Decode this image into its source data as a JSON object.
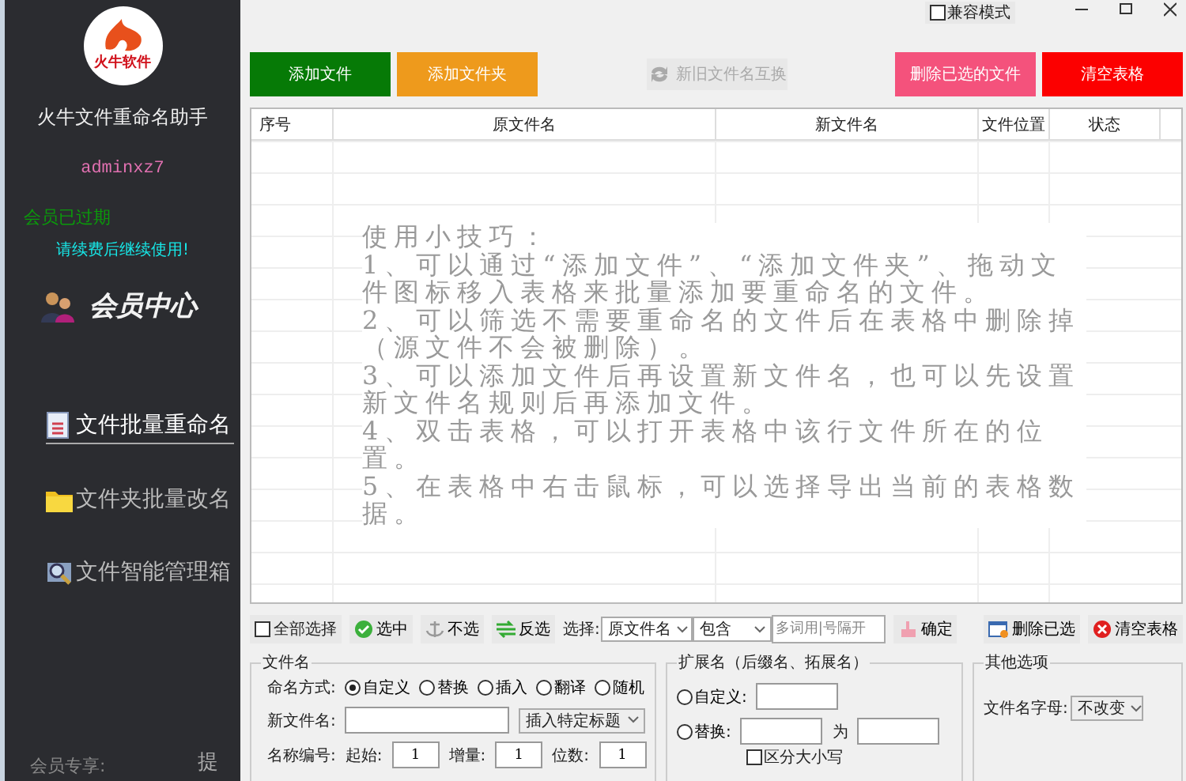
{
  "sidebar": {
    "logo_text": "火牛软件",
    "app_name": "火牛文件重命名助手",
    "username": "adminxz7",
    "membership_status": "会员已过期",
    "renew_notice": "请续费后继续使用!",
    "member_center": "会员中心",
    "nav": [
      {
        "kind": "document",
        "label": "文件批量重命名",
        "selected": true
      },
      {
        "kind": "folder",
        "label": "文件夹批量改名",
        "selected": false
      },
      {
        "kind": "search",
        "label": "文件智能管理箱",
        "selected": false
      }
    ],
    "footer_text": "会员专享:",
    "side_tab": "提"
  },
  "titlebar": {
    "compat_mode": {
      "label": "兼容模式",
      "checked": false
    }
  },
  "toolbar": [
    {
      "kind": "plain",
      "label": "添加文件",
      "color": "#067a06",
      "disabled": false
    },
    {
      "kind": "plain",
      "label": "添加文件夹",
      "color": "#ee9a1c",
      "disabled": false
    },
    {
      "kind": "swap",
      "label": "新旧文件名互换",
      "color": "#e8e8e8",
      "disabled": true
    },
    {
      "kind": "plain",
      "label": "删除已选的文件",
      "color": "#f4527c",
      "disabled": false
    },
    {
      "kind": "plain",
      "label": "清空表格",
      "color": "#fc0000",
      "disabled": false
    }
  ],
  "table": {
    "columns": [
      "序号",
      "原文件名",
      "新文件名",
      "文件位置",
      "状态"
    ],
    "tips": [
      "使用小技巧：",
      "1、可以通过“添加文件”、“添加文件夹”、拖动文件图标移入表格来批量添加要重命名的文件。",
      "2、可以筛选不需要重命名的文件后在表格中删除掉（源文件不会被删除）。",
      "3、可以添加文件后再设置新文件名，也可以先设置新文件名规则后再添加文件。",
      "4、双击表格，可以打开表格中该行文件所在的位置。",
      "5、在表格中右击鼠标，可以选择导出当前的表格数据。"
    ]
  },
  "selection_bar": {
    "select_all": {
      "label": "全部选择",
      "checked": false
    },
    "actions": [
      {
        "kind": "select",
        "label": "选中"
      },
      {
        "kind": "deselect",
        "label": "不选"
      },
      {
        "kind": "invert",
        "label": "反选"
      }
    ],
    "filter_label": "选择:",
    "field": "原文件名",
    "match": "包含",
    "keywords_placeholder": "多词用|号隔开",
    "confirm": "确定",
    "delete_selected": "删除已选",
    "clear_table": "清空表格"
  },
  "filename": {
    "title": "文件名",
    "mode_label": "命名方式:",
    "modes": [
      {
        "label": "自定义",
        "selected": true
      },
      {
        "label": "替换",
        "selected": false
      },
      {
        "label": "插入",
        "selected": false
      },
      {
        "label": "翻译",
        "selected": false
      },
      {
        "label": "随机",
        "selected": false
      }
    ],
    "new_name_label": "新文件名:",
    "insert_title": "插入特定标题",
    "numbering_label": "名称编号:",
    "start_label": "起始:",
    "start": "1",
    "step_label": "增量:",
    "step": "1",
    "digits_label": "位数:",
    "digits": "1"
  },
  "extension": {
    "title": "扩展名（后缀名、拓展名）",
    "options": [
      {
        "kind": "custom",
        "label": "自定义:",
        "selected": false
      },
      {
        "kind": "replace",
        "label": "替换:",
        "selected": false
      }
    ],
    "to_label": "为",
    "case_sensitive": {
      "label": "区分大小写",
      "checked": false
    }
  },
  "other": {
    "title": "其他选项",
    "letters_label": "文件名字母:",
    "letters": "不改变"
  }
}
